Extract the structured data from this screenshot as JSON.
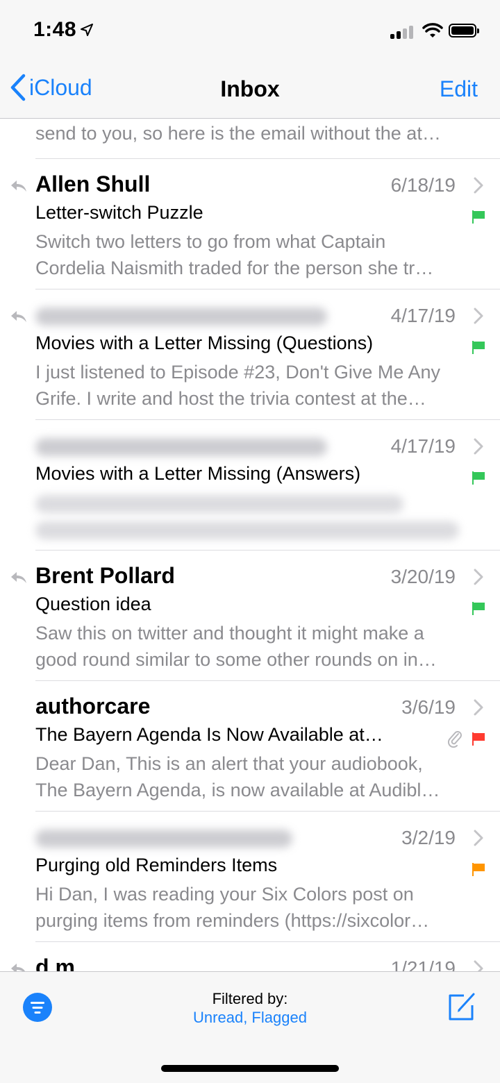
{
  "status_bar": {
    "time": "1:48"
  },
  "nav": {
    "back_label": "iCloud",
    "title": "Inbox",
    "edit_label": "Edit"
  },
  "partial_top": {
    "preview": "send to you, so here is the email without the at…"
  },
  "messages": [
    {
      "sender": "Allen Shull",
      "date": "6/18/19",
      "subject": "Letter-switch Puzzle",
      "preview1": "Switch two letters to go from what Captain",
      "preview2": "Cordelia Naismith traded for the person she tr…",
      "flag_color": "#34c759",
      "replied": true
    },
    {
      "sender": "",
      "date": "4/17/19",
      "subject": "Movies with a Letter Missing (Questions)",
      "preview1": "I just listened to Episode #23, Don't Give Me Any",
      "preview2": "Grife. I write and host the trivia contest at the…",
      "flag_color": "#34c759",
      "replied": true
    },
    {
      "sender": "",
      "date": "4/17/19",
      "subject": "Movies with a Letter Missing (Answers)",
      "preview1": "",
      "preview2": "",
      "flag_color": "#34c759",
      "replied": false
    },
    {
      "sender": "Brent Pollard",
      "date": "3/20/19",
      "subject": "Question idea",
      "preview1": "Saw this on twitter and thought it might make a",
      "preview2": "good round similar to some other rounds on in…",
      "flag_color": "#34c759",
      "replied": true
    },
    {
      "sender": "authorcare",
      "date": "3/6/19",
      "subject": "The Bayern Agenda Is Now Available at…",
      "preview1": "Dear Dan, This is an alert that your audiobook,",
      "preview2": "The Bayern Agenda, is now available at Audibl…",
      "flag_color": "#ff3b30",
      "replied": false,
      "attachment": true
    },
    {
      "sender": "",
      "date": "3/2/19",
      "subject": "Purging old Reminders Items",
      "preview1": "Hi Dan, I was reading your Six Colors post on",
      "preview2": "purging items from reminders (https://sixcolor…",
      "flag_color": "#ff9500",
      "replied": false
    },
    {
      "sender": "d.m",
      "date": "1/21/19",
      "subject": "",
      "preview1": "",
      "preview2": "",
      "replied": true
    }
  ],
  "toolbar": {
    "filter_label": "Filtered by:",
    "filter_value": "Unread, Flagged"
  },
  "icons": {
    "back": "chevron-left-icon",
    "reply": "reply-icon",
    "chevron": "chevron-right-icon",
    "flag": "flag-icon",
    "attachment": "paperclip-icon",
    "filter": "filter-icon",
    "compose": "compose-icon"
  },
  "colors": {
    "accent": "#1a82fb",
    "secondary_text": "#8a8a8e"
  }
}
